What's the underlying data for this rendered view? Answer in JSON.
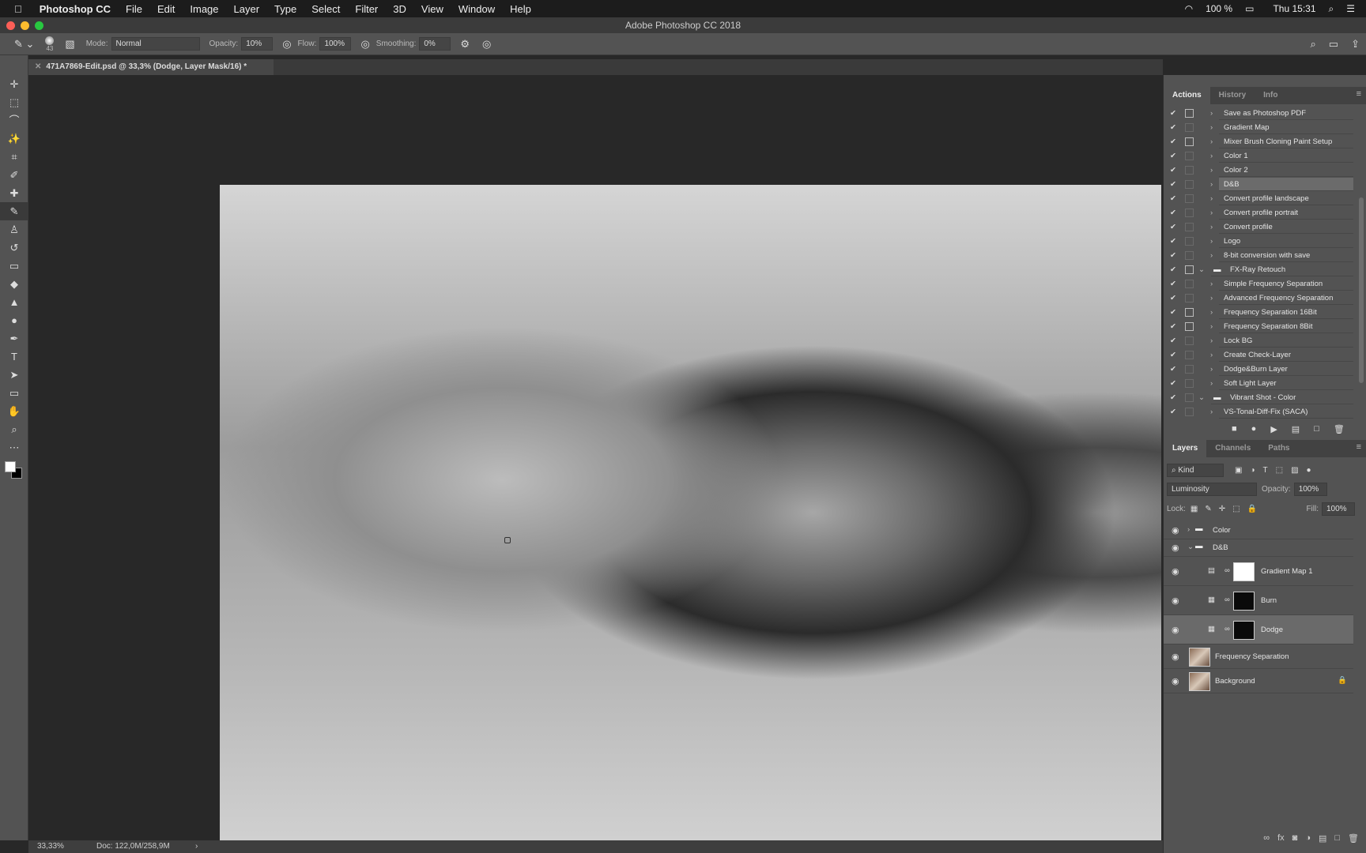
{
  "menubar": {
    "app": "Photoshop CC",
    "items": [
      "File",
      "Edit",
      "Image",
      "Layer",
      "Type",
      "Select",
      "Filter",
      "3D",
      "View",
      "Window",
      "Help"
    ],
    "battery": "100 %",
    "clock": "Thu 15:31"
  },
  "window": {
    "title": "Adobe Photoshop CC 2018"
  },
  "options": {
    "brush_size": "43",
    "mode_label": "Mode:",
    "mode": "Normal",
    "opacity_label": "Opacity:",
    "opacity": "10%",
    "flow_label": "Flow:",
    "flow": "100%",
    "smoothing_label": "Smoothing:",
    "smoothing": "0%"
  },
  "document": {
    "tab": "471A7869-Edit.psd @ 33,3% (Dodge, Layer Mask/16) *"
  },
  "status": {
    "zoom": "33,33%",
    "doc": "Doc: 122,0M/258,9M"
  },
  "actions_panel": {
    "tabs": [
      "Actions",
      "History",
      "Info"
    ],
    "active_tab": "Actions",
    "selected": "D&B",
    "items": [
      {
        "label": "Save as Photoshop PDF",
        "dialog": true
      },
      {
        "label": "Gradient Map"
      },
      {
        "label": "Mixer Brush Cloning Paint Setup",
        "dialog": true
      },
      {
        "label": "Color 1"
      },
      {
        "label": "Color 2"
      },
      {
        "label": "D&B"
      },
      {
        "label": "Convert profile landscape"
      },
      {
        "label": "Convert profile portrait"
      },
      {
        "label": "Convert profile"
      },
      {
        "label": "Logo"
      },
      {
        "label": "8-bit conversion with save"
      },
      {
        "label": "FX-Ray Retouch",
        "set": true,
        "dialog": true
      },
      {
        "label": "Simple Frequency Separation"
      },
      {
        "label": "Advanced Frequency Separation"
      },
      {
        "label": "Frequency Separation 16Bit",
        "dialog": true
      },
      {
        "label": "Frequency Separation 8Bit",
        "dialog": true
      },
      {
        "label": "Lock BG"
      },
      {
        "label": "Create Check-Layer"
      },
      {
        "label": "Dodge&Burn Layer"
      },
      {
        "label": "Soft Light Layer"
      },
      {
        "label": "Vibrant Shot - Color",
        "set": true
      },
      {
        "label": "VS-Tonal-Diff-Fix (SACA)"
      }
    ]
  },
  "layers_panel": {
    "tabs": [
      "Layers",
      "Channels",
      "Paths"
    ],
    "active_tab": "Layers",
    "filter": "Kind",
    "blend_mode": "Luminosity",
    "opacity_label": "Opacity:",
    "opacity": "100%",
    "lock_label": "Lock:",
    "fill_label": "Fill:",
    "fill": "100%",
    "layers": [
      {
        "name": "Color",
        "type": "group",
        "expanded": false
      },
      {
        "name": "D&B",
        "type": "group",
        "expanded": true
      },
      {
        "name": "Gradient Map 1",
        "type": "adjustment",
        "mask": "white"
      },
      {
        "name": "Burn",
        "type": "curves",
        "mask": "black"
      },
      {
        "name": "Dodge",
        "type": "curves",
        "mask": "black",
        "selected": true
      },
      {
        "name": "Frequency Separation",
        "type": "pixel"
      },
      {
        "name": "Background",
        "type": "pixel",
        "locked": true
      }
    ]
  }
}
